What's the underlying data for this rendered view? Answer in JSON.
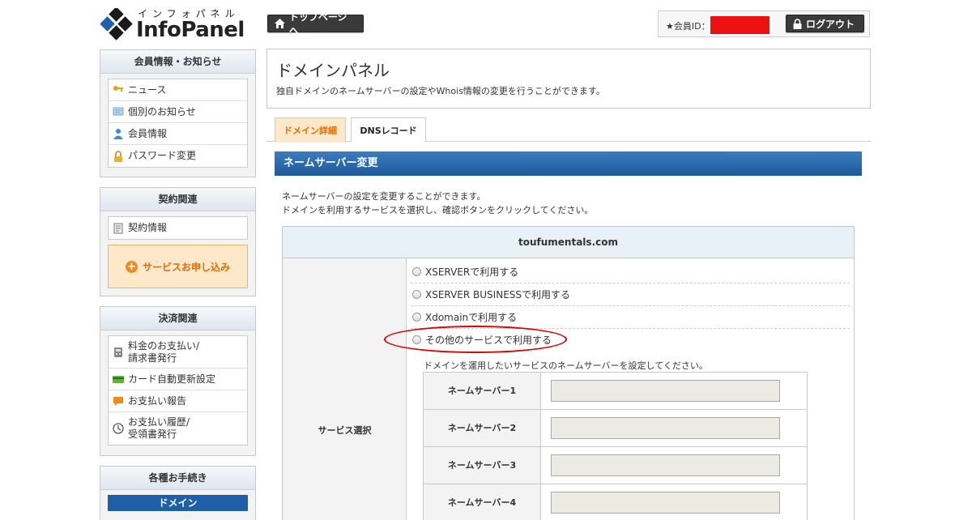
{
  "header": {
    "logo_kana": "インフォパネル",
    "logo_brand": "InfoPanel",
    "top_page_button": "トップページへ",
    "member_id_label": "★会員ID：",
    "logout_button": "ログアウト",
    "redaction_color": "#ee1111"
  },
  "sidebar": {
    "member_section": {
      "title": "会員情報・お知らせ",
      "items": [
        {
          "label": "ニュース",
          "icon": "key-icon"
        },
        {
          "label": "個別のお知らせ",
          "icon": "message-icon"
        },
        {
          "label": "会員情報",
          "icon": "user-icon"
        },
        {
          "label": "パスワード変更",
          "icon": "lock-icon"
        }
      ]
    },
    "contract_section": {
      "title": "契約関連",
      "items": [
        {
          "label": "契約情報",
          "icon": "document-icon"
        }
      ],
      "apply_button": "サービスお申し込み"
    },
    "payment_section": {
      "title": "決済関連",
      "items": [
        {
          "label": "料金のお支払い/\n請求書発行",
          "icon": "calculator-icon"
        },
        {
          "label": "カード自動更新設定",
          "icon": "credit-card-icon"
        },
        {
          "label": "お支払い報告",
          "icon": "chat-icon"
        },
        {
          "label": "お支払い履歴/\n受領書発行",
          "icon": "clock-icon"
        }
      ]
    },
    "procedure_section": {
      "title": "各種お手続き",
      "domain_bar": "ドメイン"
    }
  },
  "main": {
    "title": "ドメインパネル",
    "description": "独自ドメインのネームサーバーの設定やWhois情報の変更を行うことができます。",
    "tabs": [
      {
        "label": "ドメイン詳細",
        "active": true
      },
      {
        "label": "DNSレコード",
        "active": false
      }
    ],
    "section_title": "ネームサーバー変更",
    "intro_line1": "ネームサーバーの設定を変更することができます。",
    "intro_line2": "ドメインを利用するサービスを選択し、確認ボタンをクリックしてください。",
    "domain_name": "toufumentals.com",
    "service_label": "サービス選択",
    "service_options": [
      {
        "label": "XSERVERで利用する",
        "selected": false
      },
      {
        "label": "XSERVER BUSINESSで利用する",
        "selected": false
      },
      {
        "label": "Xdomainで利用する",
        "selected": false
      },
      {
        "label": "その他のサービスで利用する",
        "selected": false
      }
    ],
    "nameserver_note": "ドメインを運用したいサービスのネームサーバーを設定してください。",
    "nameservers": [
      {
        "label": "ネームサーバー1",
        "value": ""
      },
      {
        "label": "ネームサーバー2",
        "value": ""
      },
      {
        "label": "ネームサーバー3",
        "value": ""
      },
      {
        "label": "ネームサーバー4",
        "value": ""
      }
    ]
  },
  "colors": {
    "accent_blue": "#1e5a9c",
    "accent_orange": "#e36c09",
    "highlight_red": "#e00000"
  }
}
